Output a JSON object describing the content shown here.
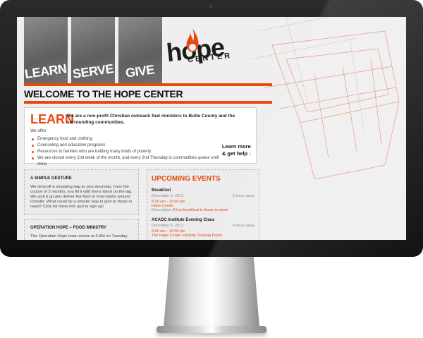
{
  "nav": [
    {
      "label": "LEARN"
    },
    {
      "label": "SERVE"
    },
    {
      "label": "GIVE"
    }
  ],
  "logo": {
    "word": "hope",
    "sub": "CENTER"
  },
  "welcome": "WELCOME TO THE HOPE CENTER",
  "learn": {
    "title": "LEARN",
    "intro": "We are a non-profit Christian outreach that ministers to Butte County and the surrounding communities.",
    "we_offer": "We offer",
    "items": [
      "Emergency food and clothing",
      "Counseling and education programs",
      "Resources to families who are battling many kinds of poverty",
      "We are closed every 2nd week of the month, and every 2nd Thursday is commodities queue until done"
    ],
    "more_line1": "Learn more",
    "more_line2": "& get help",
    "more_arrow": "↓"
  },
  "gesture": {
    "title": "A SIMPLE GESTURE",
    "text": "We drop off a shopping bag to your doorstep. Over the course of 2 months, you fill it with items listed on the tag. We pick it up and deliver the food to food banks around Oroville. What could be a simpler way to give to those in need? Click for more info and to sign up!"
  },
  "ministry": {
    "title": "OPERATION HOPE – FOOD MINISTRY",
    "text": "The Operation Hope team meets at 6 AM on Tuesday,"
  },
  "events": {
    "title": "UPCOMING EVENTS",
    "items": [
      {
        "name": "Breakfast",
        "date": "December 6, 2012",
        "ago": "6 hours away",
        "time": "8:30 am - 10:00 am",
        "location": "Hope Center",
        "desc_label": "Description:",
        "desc": "A hot breakfast to those in need"
      },
      {
        "name": "ACADC Institute Evening Class",
        "date": "December 6, 2012",
        "ago": "4 hours away",
        "time": "9:00 am - 12:00 pm",
        "location": "The Hope Center Institute Training Room"
      }
    ]
  },
  "colors": {
    "accent": "#e8480e",
    "bezel": "#111111",
    "screen_bg": "#efefef"
  }
}
